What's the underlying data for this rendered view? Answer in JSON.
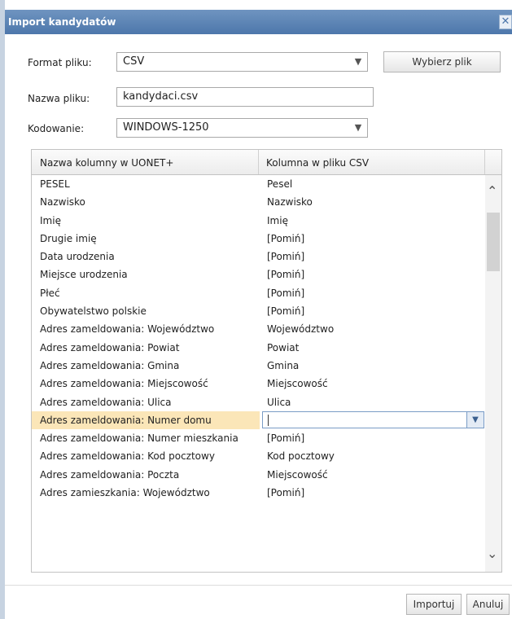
{
  "dialog": {
    "title": "Import kandydatów",
    "close_label": "✕"
  },
  "form": {
    "format_label": "Format pliku:",
    "format_value": "CSV",
    "choose_file_label": "Wybierz plik",
    "filename_label": "Nazwa pliku:",
    "filename_value": "kandydaci.csv",
    "encoding_label": "Kodowanie:",
    "encoding_value": "WINDOWS-1250"
  },
  "grid": {
    "columns": [
      "Nazwa kolumny w UONET+",
      "Kolumna w pliku CSV"
    ],
    "rows": [
      [
        "PESEL",
        "Pesel"
      ],
      [
        "Nazwisko",
        "Nazwisko"
      ],
      [
        "Imię",
        "Imię"
      ],
      [
        "Drugie imię",
        "[Pomiń]"
      ],
      [
        "Data urodzenia",
        "[Pomiń]"
      ],
      [
        "Miejsce urodzenia",
        "[Pomiń]"
      ],
      [
        "Płeć",
        "[Pomiń]"
      ],
      [
        "Obywatelstwo polskie",
        "[Pomiń]"
      ],
      [
        "Adres zameldowania: Województwo",
        "Województwo"
      ],
      [
        "Adres zameldowania: Powiat",
        "Powiat"
      ],
      [
        "Adres zameldowania: Gmina",
        "Gmina"
      ],
      [
        "Adres zameldowania: Miejscowość",
        "Miejscowość"
      ],
      [
        "Adres zameldowania: Ulica",
        "Ulica"
      ],
      [
        "Adres zameldowania: Numer domu",
        ""
      ],
      [
        "Adres zameldowania: Numer mieszkania",
        "[Pomiń]"
      ],
      [
        "Adres zameldowania: Kod pocztowy",
        "Kod pocztowy"
      ],
      [
        "Adres zameldowania: Poczta",
        "Miejscowość"
      ],
      [
        "Adres zamieszkania: Województwo",
        "[Pomiń]"
      ]
    ],
    "selected_row": 13
  },
  "icons": {
    "dropdown": "chevron-down-icon",
    "scroll_up": "chevron-up-icon",
    "scroll_down": "chevron-down-icon"
  },
  "footer": {
    "import_label": "Importuj",
    "cancel_label": "Anuluj"
  },
  "colors": {
    "title_bar": "#5a82b4",
    "selected_row": "#fbe6b8"
  }
}
